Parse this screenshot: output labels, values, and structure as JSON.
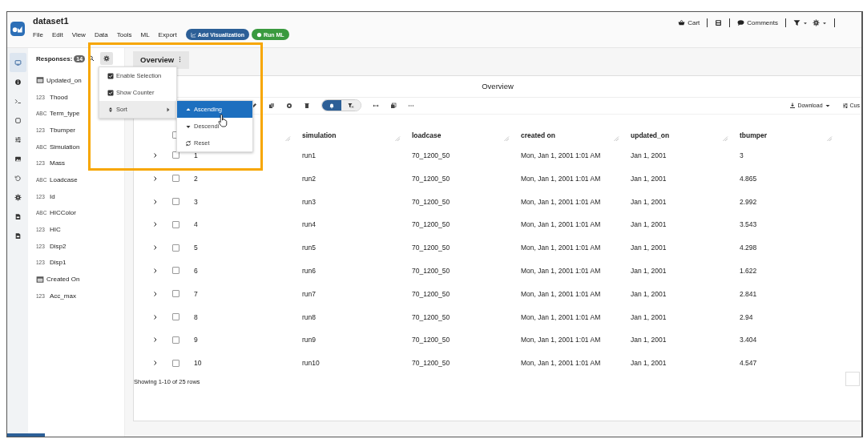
{
  "app": {
    "title": "dataset1",
    "menu": [
      "File",
      "Edit",
      "View",
      "Data",
      "Tools",
      "ML",
      "Export"
    ],
    "actions": [
      {
        "kind": "primary",
        "label": "Add Visualization"
      },
      {
        "kind": "success",
        "label": "Run ML"
      }
    ],
    "top_right": [
      {
        "kind": "cart",
        "label": "Cart"
      },
      {
        "kind": "film"
      },
      {
        "kind": "comments",
        "label": "Comments"
      },
      {
        "kind": "filter"
      },
      {
        "kind": "gear"
      }
    ]
  },
  "rail": [
    {
      "kind": "monitor",
      "selected": true
    },
    {
      "kind": "info",
      "selected": false
    },
    {
      "kind": "terminal",
      "selected": false
    },
    {
      "kind": "square",
      "selected": false
    },
    {
      "kind": "sliders",
      "selected": false
    },
    {
      "kind": "image",
      "selected": false
    },
    {
      "kind": "history",
      "selected": false
    },
    {
      "kind": "gear",
      "selected": false
    },
    {
      "kind": "file",
      "selected": false
    },
    {
      "kind": "file",
      "selected": false
    }
  ],
  "responses": {
    "label": "Responses:",
    "count": "14",
    "items": [
      {
        "kind": "date",
        "name": "Updated_on"
      },
      {
        "kind": "number",
        "badge": "123",
        "name": "Thood"
      },
      {
        "kind": "text",
        "badge": "ABC",
        "name": "Term_type"
      },
      {
        "kind": "number",
        "badge": "123",
        "name": "Tbumper"
      },
      {
        "kind": "text",
        "badge": "ABC",
        "name": "Simulation"
      },
      {
        "kind": "number",
        "badge": "123",
        "name": "Mass"
      },
      {
        "kind": "text",
        "badge": "ABC",
        "name": "Loadcase"
      },
      {
        "kind": "number",
        "badge": "123",
        "name": "Id"
      },
      {
        "kind": "text",
        "badge": "ABC",
        "name": "HICColor"
      },
      {
        "kind": "number",
        "badge": "123",
        "name": "HIC"
      },
      {
        "kind": "number",
        "badge": "123",
        "name": "Disp2"
      },
      {
        "kind": "number",
        "badge": "123",
        "name": "Disp1"
      },
      {
        "kind": "date",
        "name": "Created On"
      },
      {
        "kind": "number",
        "badge": "123",
        "name": "Acc_max"
      }
    ]
  },
  "settings_menu": {
    "items": [
      {
        "kind": "check",
        "label": "Enable Selection",
        "checked": true
      },
      {
        "kind": "check",
        "label": "Show Counter",
        "checked": true
      },
      {
        "kind": "submenu",
        "label": "Sort",
        "expanded": true
      }
    ]
  },
  "sort_submenu": [
    {
      "kind": "asc",
      "label": "Ascending",
      "selected": true
    },
    {
      "kind": "desc",
      "label": "Descendi",
      "selected": false
    },
    {
      "kind": "reset",
      "label": "Reset",
      "selected": false
    }
  ],
  "tabs": [
    {
      "label": "Overview",
      "selected": true
    }
  ],
  "card": {
    "title": "Overview",
    "toolbar": [
      {
        "kind": "edit"
      },
      {
        "kind": "copy"
      },
      {
        "kind": "circle"
      },
      {
        "kind": "trash"
      },
      {
        "kind": "toggle"
      },
      {
        "kind": "arrows"
      },
      {
        "kind": "clone"
      },
      {
        "kind": "more"
      }
    ],
    "toggle": [
      {
        "kind": "bell",
        "selected": true
      },
      {
        "kind": "filter-x",
        "selected": false
      }
    ],
    "download": "Download",
    "custom": "Cus",
    "header_checked": false,
    "columns": [
      "simulation",
      "loadcase",
      "created on",
      "updated_on",
      "tbumper"
    ],
    "rows": [
      {
        "id": "1",
        "cells": [
          "run1",
          "70_1200_50",
          "Mon, Jan 1, 2001 1:01 AM",
          "Jan 1, 2001",
          "3"
        ],
        "expanded": false,
        "checked": false
      },
      {
        "id": "2",
        "cells": [
          "run2",
          "70_1200_50",
          "Mon, Jan 1, 2001 1:01 AM",
          "Jan 1, 2001",
          "4.865"
        ],
        "expanded": false,
        "checked": false
      },
      {
        "id": "3",
        "cells": [
          "run3",
          "70_1200_50",
          "Mon, Jan 1, 2001 1:01 AM",
          "Jan 1, 2001",
          "2.992"
        ],
        "expanded": false,
        "checked": false
      },
      {
        "id": "4",
        "cells": [
          "run4",
          "70_1200_50",
          "Mon, Jan 1, 2001 1:01 AM",
          "Jan 1, 2001",
          "3.543"
        ],
        "expanded": false,
        "checked": false
      },
      {
        "id": "5",
        "cells": [
          "run5",
          "70_1200_50",
          "Mon, Jan 1, 2001 1:01 AM",
          "Jan 1, 2001",
          "4.298"
        ],
        "expanded": false,
        "checked": false
      },
      {
        "id": "6",
        "cells": [
          "run6",
          "70_1200_50",
          "Mon, Jan 1, 2001 1:01 AM",
          "Jan 1, 2001",
          "1.622"
        ],
        "expanded": false,
        "checked": false
      },
      {
        "id": "7",
        "cells": [
          "run7",
          "70_1200_50",
          "Mon, Jan 1, 2001 1:01 AM",
          "Jan 1, 2001",
          "2.841"
        ],
        "expanded": false,
        "checked": false
      },
      {
        "id": "8",
        "cells": [
          "run8",
          "70_1200_50",
          "Mon, Jan 1, 2001 1:01 AM",
          "Jan 1, 2001",
          "2.94"
        ],
        "expanded": false,
        "checked": false
      },
      {
        "id": "9",
        "cells": [
          "run9",
          "70_1200_50",
          "Mon, Jan 1, 2001 1:01 AM",
          "Jan 1, 2001",
          "3.404"
        ],
        "expanded": false,
        "checked": false
      },
      {
        "id": "10",
        "cells": [
          "run10",
          "70_1200_50",
          "Mon, Jan 1, 2001 1:01 AM",
          "Jan 1, 2001",
          "4.547"
        ],
        "expanded": false,
        "checked": false
      }
    ],
    "footer": "Showing 1-10 of 25 rows"
  }
}
